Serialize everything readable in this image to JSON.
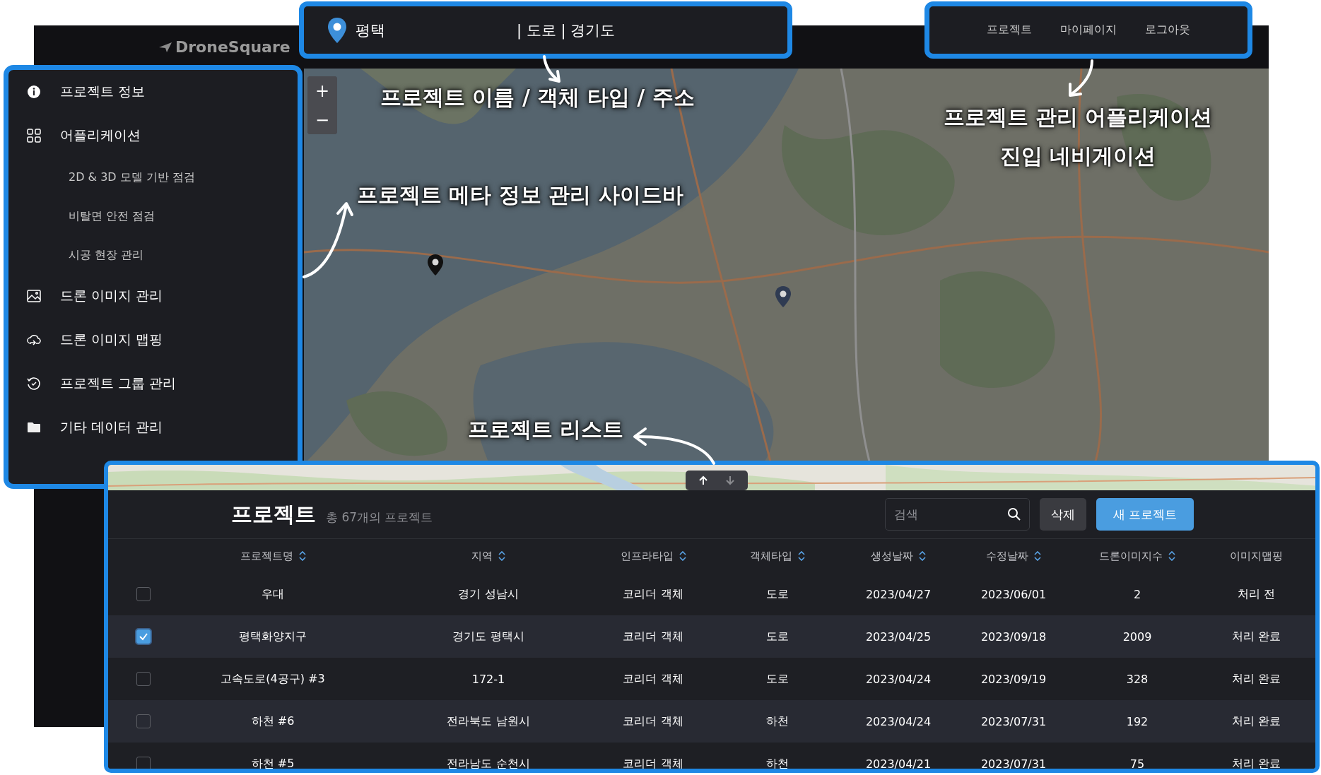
{
  "header": {
    "logo": "DroneSquare"
  },
  "project_bar": {
    "name": "평택",
    "details": "| 도로 | 경기도"
  },
  "nav": [
    {
      "label": "프로젝트"
    },
    {
      "label": "마이페이지"
    },
    {
      "label": "로그아웃"
    }
  ],
  "sidebar": {
    "items": [
      {
        "label": "프로젝트 정보"
      },
      {
        "label": "어플리케이션",
        "children": [
          {
            "label": "2D & 3D 모델 기반 점검"
          },
          {
            "label": "비탈면 안전 점검"
          },
          {
            "label": "시공 현장 관리"
          }
        ]
      },
      {
        "label": "드론 이미지 관리"
      },
      {
        "label": "드론 이미지 맵핑"
      },
      {
        "label": "프로젝트 그룹 관리"
      },
      {
        "label": "기타 데이터 관리"
      }
    ]
  },
  "map": {
    "zoom_in": "+",
    "zoom_out": "−"
  },
  "annotations": [
    {
      "text": "프로젝트 이름 / 객체 타입 / 주소"
    },
    {
      "text": "프로젝트 관리 어플리케이션\n진입 네비게이션"
    },
    {
      "text": "프로젝트 메타 정보 관리 사이드바"
    },
    {
      "text": "프로젝트 리스트"
    }
  ],
  "panel_toggle": [
    {
      "kind": "up",
      "selected": true
    },
    {
      "kind": "down",
      "selected": false
    }
  ],
  "table": {
    "title": "프로젝트",
    "count": "총 67개의 프로젝트",
    "search": {
      "placeholder": "검색"
    },
    "buttons": [
      {
        "label": "삭제",
        "kind": "secondary"
      },
      {
        "label": "새 프로젝트",
        "kind": "primary"
      }
    ],
    "columns": [
      {
        "label": "프로젝트명",
        "sortable": true
      },
      {
        "label": "지역",
        "sortable": true
      },
      {
        "label": "인프라타입",
        "sortable": true
      },
      {
        "label": "객체타입",
        "sortable": true
      },
      {
        "label": "생성날짜",
        "sortable": true
      },
      {
        "label": "수정날짜",
        "sortable": true
      },
      {
        "label": "드론이미지수",
        "sortable": true
      },
      {
        "label": "이미지맵핑",
        "sortable": false
      }
    ],
    "rows": [
      {
        "selected": false,
        "cells": [
          "우대",
          "경기 성남시",
          "코리더 객체",
          "도로",
          "2023/04/27",
          "2023/06/01",
          "2",
          "처리 전"
        ]
      },
      {
        "selected": true,
        "cells": [
          "평택화양지구",
          "경기도 평택시",
          "코리더 객체",
          "도로",
          "2023/04/25",
          "2023/09/18",
          "2009",
          "처리 완료"
        ]
      },
      {
        "selected": false,
        "cells": [
          "고속도로(4공구) #3",
          "172-1",
          "코리더 객체",
          "도로",
          "2023/04/24",
          "2023/09/19",
          "328",
          "처리 완료"
        ]
      },
      {
        "selected": false,
        "cells": [
          "하천 #6",
          "전라북도 남원시",
          "코리더 객체",
          "하천",
          "2023/04/24",
          "2023/07/31",
          "192",
          "처리 완료"
        ]
      },
      {
        "selected": false,
        "cells": [
          "하천 #5",
          "전라남도 순천시",
          "코리더 객체",
          "하천",
          "2023/04/21",
          "2023/07/31",
          "75",
          "처리 완료"
        ]
      }
    ]
  }
}
